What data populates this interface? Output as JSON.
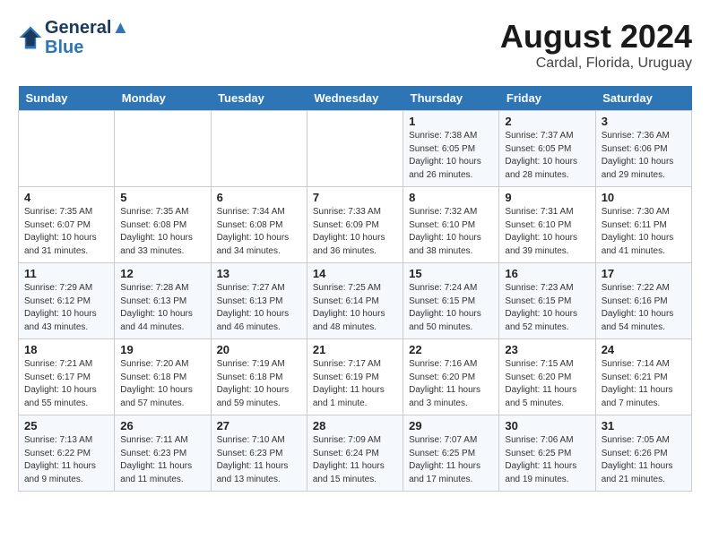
{
  "header": {
    "logo_line1": "General",
    "logo_line2": "Blue",
    "month_year": "August 2024",
    "location": "Cardal, Florida, Uruguay"
  },
  "weekdays": [
    "Sunday",
    "Monday",
    "Tuesday",
    "Wednesday",
    "Thursday",
    "Friday",
    "Saturday"
  ],
  "weeks": [
    [
      {
        "day": "",
        "info": ""
      },
      {
        "day": "",
        "info": ""
      },
      {
        "day": "",
        "info": ""
      },
      {
        "day": "",
        "info": ""
      },
      {
        "day": "1",
        "info": "Sunrise: 7:38 AM\nSunset: 6:05 PM\nDaylight: 10 hours\nand 26 minutes."
      },
      {
        "day": "2",
        "info": "Sunrise: 7:37 AM\nSunset: 6:05 PM\nDaylight: 10 hours\nand 28 minutes."
      },
      {
        "day": "3",
        "info": "Sunrise: 7:36 AM\nSunset: 6:06 PM\nDaylight: 10 hours\nand 29 minutes."
      }
    ],
    [
      {
        "day": "4",
        "info": "Sunrise: 7:35 AM\nSunset: 6:07 PM\nDaylight: 10 hours\nand 31 minutes."
      },
      {
        "day": "5",
        "info": "Sunrise: 7:35 AM\nSunset: 6:08 PM\nDaylight: 10 hours\nand 33 minutes."
      },
      {
        "day": "6",
        "info": "Sunrise: 7:34 AM\nSunset: 6:08 PM\nDaylight: 10 hours\nand 34 minutes."
      },
      {
        "day": "7",
        "info": "Sunrise: 7:33 AM\nSunset: 6:09 PM\nDaylight: 10 hours\nand 36 minutes."
      },
      {
        "day": "8",
        "info": "Sunrise: 7:32 AM\nSunset: 6:10 PM\nDaylight: 10 hours\nand 38 minutes."
      },
      {
        "day": "9",
        "info": "Sunrise: 7:31 AM\nSunset: 6:10 PM\nDaylight: 10 hours\nand 39 minutes."
      },
      {
        "day": "10",
        "info": "Sunrise: 7:30 AM\nSunset: 6:11 PM\nDaylight: 10 hours\nand 41 minutes."
      }
    ],
    [
      {
        "day": "11",
        "info": "Sunrise: 7:29 AM\nSunset: 6:12 PM\nDaylight: 10 hours\nand 43 minutes."
      },
      {
        "day": "12",
        "info": "Sunrise: 7:28 AM\nSunset: 6:13 PM\nDaylight: 10 hours\nand 44 minutes."
      },
      {
        "day": "13",
        "info": "Sunrise: 7:27 AM\nSunset: 6:13 PM\nDaylight: 10 hours\nand 46 minutes."
      },
      {
        "day": "14",
        "info": "Sunrise: 7:25 AM\nSunset: 6:14 PM\nDaylight: 10 hours\nand 48 minutes."
      },
      {
        "day": "15",
        "info": "Sunrise: 7:24 AM\nSunset: 6:15 PM\nDaylight: 10 hours\nand 50 minutes."
      },
      {
        "day": "16",
        "info": "Sunrise: 7:23 AM\nSunset: 6:15 PM\nDaylight: 10 hours\nand 52 minutes."
      },
      {
        "day": "17",
        "info": "Sunrise: 7:22 AM\nSunset: 6:16 PM\nDaylight: 10 hours\nand 54 minutes."
      }
    ],
    [
      {
        "day": "18",
        "info": "Sunrise: 7:21 AM\nSunset: 6:17 PM\nDaylight: 10 hours\nand 55 minutes."
      },
      {
        "day": "19",
        "info": "Sunrise: 7:20 AM\nSunset: 6:18 PM\nDaylight: 10 hours\nand 57 minutes."
      },
      {
        "day": "20",
        "info": "Sunrise: 7:19 AM\nSunset: 6:18 PM\nDaylight: 10 hours\nand 59 minutes."
      },
      {
        "day": "21",
        "info": "Sunrise: 7:17 AM\nSunset: 6:19 PM\nDaylight: 11 hours\nand 1 minute."
      },
      {
        "day": "22",
        "info": "Sunrise: 7:16 AM\nSunset: 6:20 PM\nDaylight: 11 hours\nand 3 minutes."
      },
      {
        "day": "23",
        "info": "Sunrise: 7:15 AM\nSunset: 6:20 PM\nDaylight: 11 hours\nand 5 minutes."
      },
      {
        "day": "24",
        "info": "Sunrise: 7:14 AM\nSunset: 6:21 PM\nDaylight: 11 hours\nand 7 minutes."
      }
    ],
    [
      {
        "day": "25",
        "info": "Sunrise: 7:13 AM\nSunset: 6:22 PM\nDaylight: 11 hours\nand 9 minutes."
      },
      {
        "day": "26",
        "info": "Sunrise: 7:11 AM\nSunset: 6:23 PM\nDaylight: 11 hours\nand 11 minutes."
      },
      {
        "day": "27",
        "info": "Sunrise: 7:10 AM\nSunset: 6:23 PM\nDaylight: 11 hours\nand 13 minutes."
      },
      {
        "day": "28",
        "info": "Sunrise: 7:09 AM\nSunset: 6:24 PM\nDaylight: 11 hours\nand 15 minutes."
      },
      {
        "day": "29",
        "info": "Sunrise: 7:07 AM\nSunset: 6:25 PM\nDaylight: 11 hours\nand 17 minutes."
      },
      {
        "day": "30",
        "info": "Sunrise: 7:06 AM\nSunset: 6:25 PM\nDaylight: 11 hours\nand 19 minutes."
      },
      {
        "day": "31",
        "info": "Sunrise: 7:05 AM\nSunset: 6:26 PM\nDaylight: 11 hours\nand 21 minutes."
      }
    ]
  ]
}
